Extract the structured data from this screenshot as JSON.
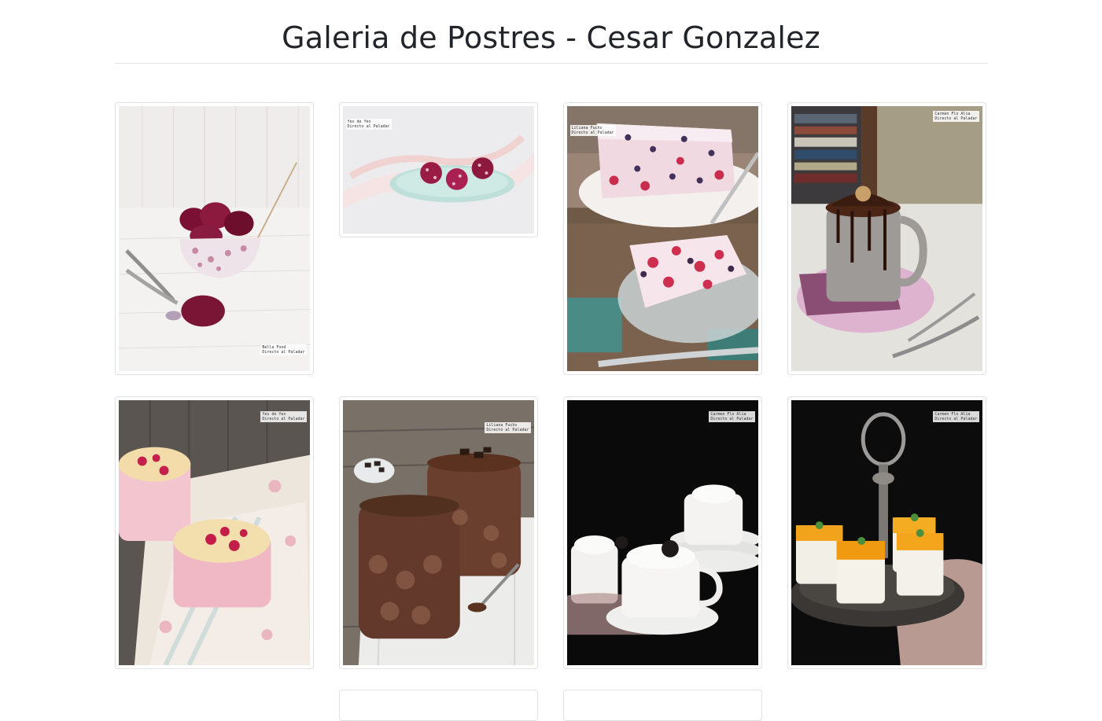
{
  "header": {
    "title": "Galeria de Postres - Cesar Gonzalez"
  },
  "gallery": {
    "items": [
      {
        "name": "berry-sorbet-photo",
        "watermark": "Bella Food\nDirecto al Paladar"
      },
      {
        "name": "coconut-truffles-photo",
        "watermark": "Yes de Yes\nDirecto al Paladar"
      },
      {
        "name": "berry-semifreddo-photo",
        "watermark": "Liliana Fuchs\nDirecto al Paladar"
      },
      {
        "name": "chocolate-mug-cake-photo",
        "watermark": "Carmen Flo Alia\nDirecto al Paladar"
      },
      {
        "name": "raspberry-clafoutis-photo",
        "watermark": "Yes de Yes\nDirecto al Paladar"
      },
      {
        "name": "chocolate-mousse-photo",
        "watermark": "Liliana Fuchs\nDirecto al Paladar"
      },
      {
        "name": "cookies-cream-cups-photo",
        "watermark": "Carmen Flo Alia\nDirecto al Paladar"
      },
      {
        "name": "mango-panna-cotta-photo",
        "watermark": "Carmen Flo Alia\nDirecto al Paladar"
      }
    ]
  }
}
